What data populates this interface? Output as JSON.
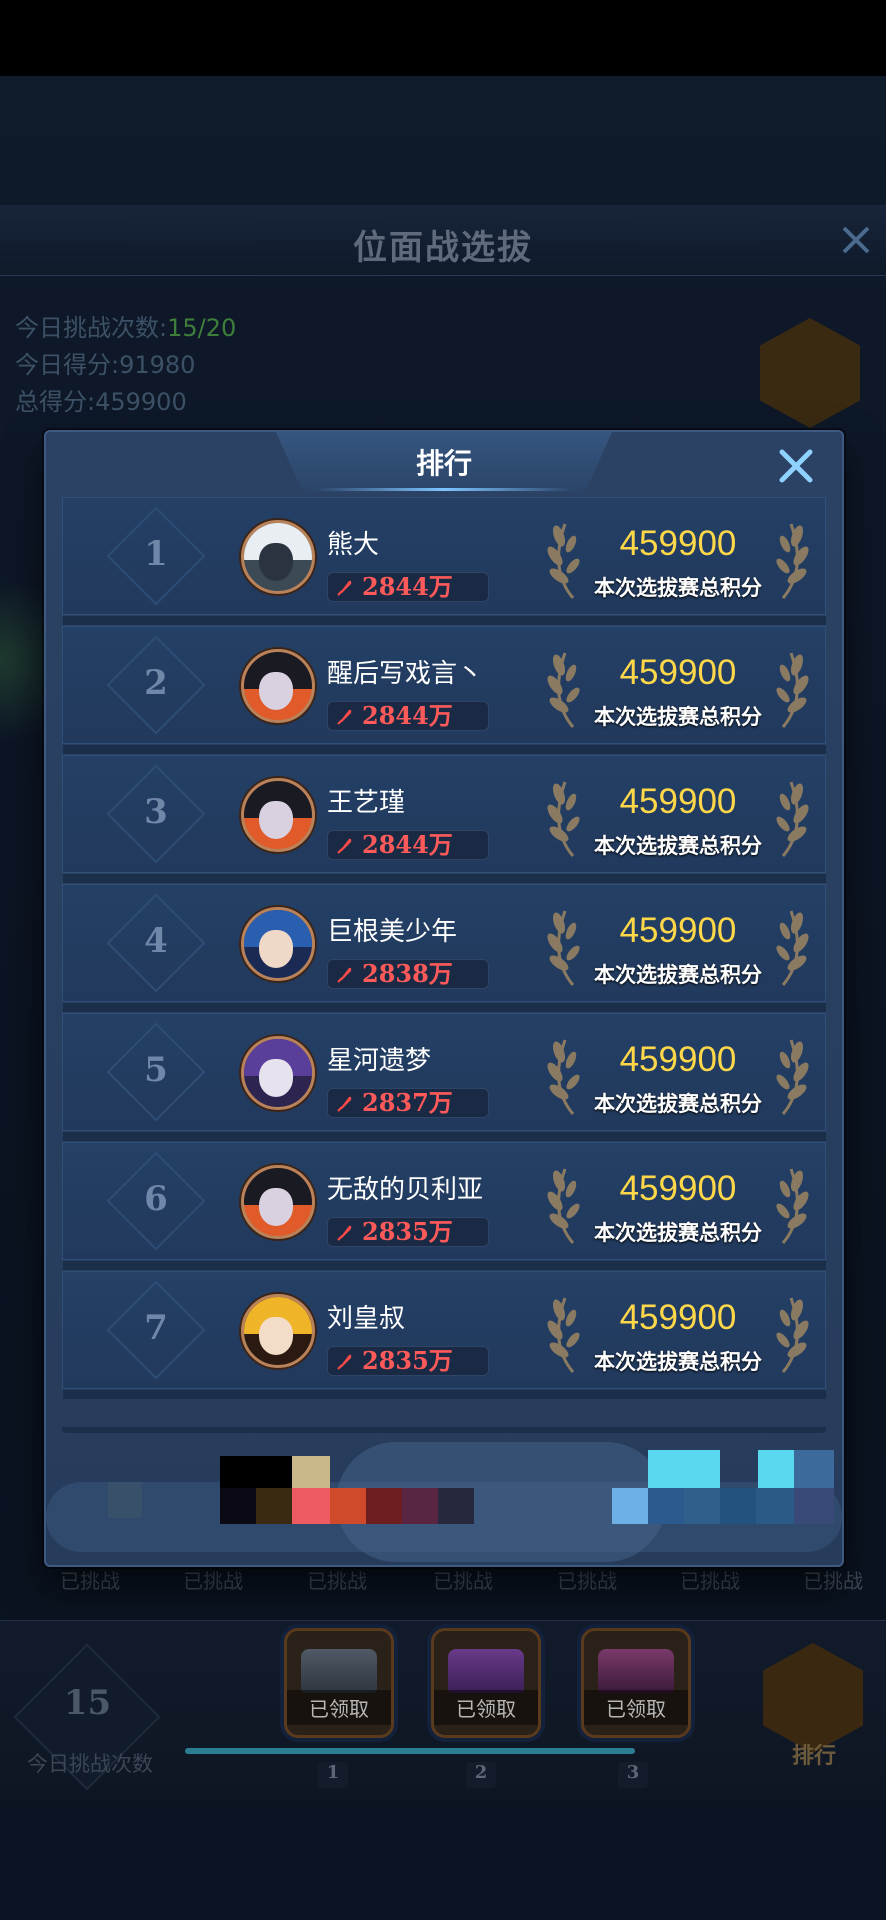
{
  "background": {
    "title": "位面战选拔",
    "stats": [
      {
        "label": "今日挑战次数:",
        "value": "15/20"
      },
      {
        "label": "今日得分:",
        "value": "91980"
      },
      {
        "label": "总得分:",
        "value": "459900"
      }
    ],
    "challenged_labels": [
      "已挑战",
      "已挑战",
      "已挑战",
      "已挑战",
      "已挑战",
      "已挑战",
      "已挑战"
    ],
    "daily_count": "15",
    "daily_count_label": "今日挑战次数",
    "chests": [
      {
        "status": "已领取",
        "milestone": "1"
      },
      {
        "status": "已领取",
        "milestone": "2"
      },
      {
        "status": "已领取",
        "milestone": "3"
      }
    ],
    "progress": 1.0,
    "ranking_button": "排行"
  },
  "modal": {
    "title": "排行",
    "rows": [
      {
        "rank": "1",
        "name": "熊大",
        "power": "2844万",
        "score": "459900",
        "score_label": "本次选拔赛总积分",
        "avatar": {
          "hair": "#e8eef2",
          "face": "#2a3440",
          "bg": "#3c4a55"
        }
      },
      {
        "rank": "2",
        "name": "醒后写戏言丶",
        "power": "2844万",
        "score": "459900",
        "score_label": "本次选拔赛总积分",
        "avatar": {
          "hair": "#1a1a22",
          "face": "#d9d0e0",
          "bg": "#e05a2a"
        }
      },
      {
        "rank": "3",
        "name": "王艺瑾",
        "power": "2844万",
        "score": "459900",
        "score_label": "本次选拔赛总积分",
        "avatar": {
          "hair": "#1a1a22",
          "face": "#d9d0e0",
          "bg": "#e05a2a"
        }
      },
      {
        "rank": "4",
        "name": "巨根美少年",
        "power": "2838万",
        "score": "459900",
        "score_label": "本次选拔赛总积分",
        "avatar": {
          "hair": "#2a5fb0",
          "face": "#f0d8c8",
          "bg": "#1b2a55"
        }
      },
      {
        "rank": "5",
        "name": "星河遗梦",
        "power": "2837万",
        "score": "459900",
        "score_label": "本次选拔赛总积分",
        "avatar": {
          "hair": "#5a3f9a",
          "face": "#e6e2ee",
          "bg": "#2d2550"
        }
      },
      {
        "rank": "6",
        "name": "无敌的贝利亚",
        "power": "2835万",
        "score": "459900",
        "score_label": "本次选拔赛总积分",
        "avatar": {
          "hair": "#1a1a22",
          "face": "#d9d0e0",
          "bg": "#e05a2a"
        }
      },
      {
        "rank": "7",
        "name": "刘皇叔",
        "power": "2835万",
        "score": "459900",
        "score_label": "本次选拔赛总积分",
        "avatar": {
          "hair": "#f0b428",
          "face": "#f3dcc8",
          "bg": "#2a1a12"
        }
      }
    ]
  },
  "colors": {
    "score": "#ffd84a",
    "power": "#ff5a5a",
    "accent_close": "#7ec4ff",
    "avatar_ring": "#b8825a"
  },
  "icons": {
    "close": "close-icon",
    "power": "power-feather-icon",
    "laurel": "laurel-wreath-icon",
    "trophy": "trophy-icon",
    "chest": "treasure-chest-icon"
  }
}
